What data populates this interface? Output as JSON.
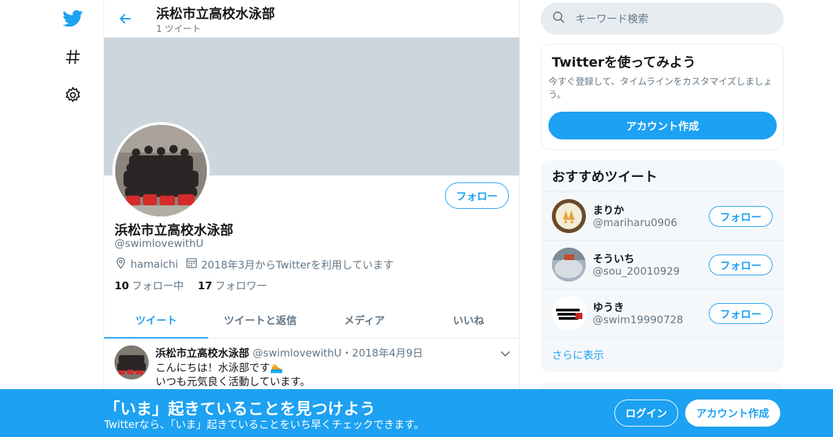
{
  "colors": {
    "accent": "#1da1f2",
    "banner": "#ccd6dd",
    "muted": "#657786",
    "border": "#e6ecf0"
  },
  "nav": {
    "icons": [
      "twitter-logo-icon",
      "hashtag-icon",
      "gear-icon"
    ]
  },
  "header": {
    "title": "浜松市立高校水泳部",
    "subtitle": "1 ツイート"
  },
  "profile": {
    "name": "浜松市立高校水泳部",
    "handle": "@swimlovewithU",
    "location": "hamaichi",
    "joined": "2018年3月からTwitterを利用しています",
    "following_count": "10",
    "following_label": "フォロー中",
    "followers_count": "17",
    "followers_label": "フォロワー",
    "follow_button": "フォロー"
  },
  "tabs": [
    {
      "label": "ツイート",
      "active": true
    },
    {
      "label": "ツイートと返信",
      "active": false
    },
    {
      "label": "メディア",
      "active": false
    },
    {
      "label": "いいね",
      "active": false
    }
  ],
  "tweet": {
    "author": "浜松市立高校水泳部",
    "handle": "@swimlovewithU",
    "separator": "・",
    "date": "2018年4月9日",
    "lines": [
      "こんにちは！水泳部です🏊",
      "いつも元気良く活動しています。"
    ]
  },
  "search": {
    "placeholder": "キーワード検索"
  },
  "signup_card": {
    "title": "Twitterを使ってみよう",
    "description": "今すぐ登録して、タイムラインをカスタマイズしましょう。",
    "button": "アカウント作成"
  },
  "recommendations": {
    "title": "おすすめツイート",
    "follow_label": "フォロー",
    "items": [
      {
        "name": "まりか",
        "handle": "@mariharu0906"
      },
      {
        "name": "そういち",
        "handle": "@sou_20010929"
      },
      {
        "name": "ゆうき",
        "handle": "@swim19990728"
      }
    ],
    "more": "さらに表示"
  },
  "bottom_bar": {
    "title": "「いま」起きていることを見つけよう",
    "subtitle": "Twitterなら、「いま」起きていることをいち早くチェックできます。",
    "login": "ログイン",
    "signup": "アカウント作成"
  }
}
